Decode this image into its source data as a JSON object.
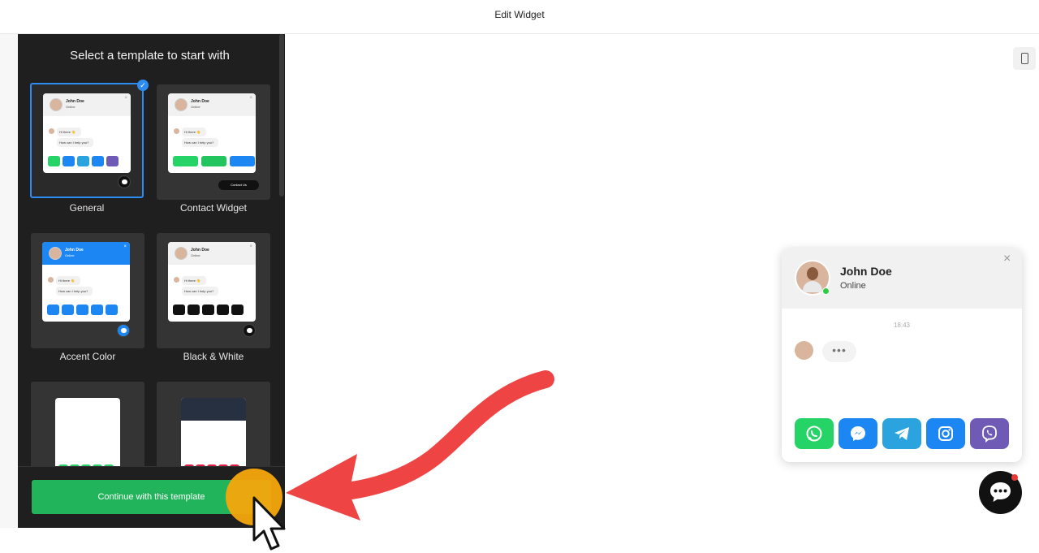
{
  "header": {
    "title": "Edit Widget"
  },
  "panel": {
    "heading": "Select a template to start with",
    "templates": [
      {
        "name": "General",
        "selected": true
      },
      {
        "name": "Contact Widget",
        "selected": false
      },
      {
        "name": "Accent Color",
        "selected": false
      },
      {
        "name": "Black & White",
        "selected": false
      },
      {
        "name": "",
        "selected": false
      },
      {
        "name": "",
        "selected": false
      }
    ],
    "continue_label": "Continue with this template"
  },
  "thumb": {
    "name": "John Doe",
    "status": "Online",
    "greeting": "Hi there 👋",
    "question": "How can I help you?",
    "contact_pill": "Contact Us"
  },
  "preview": {
    "name": "John Doe",
    "status": "Online",
    "time": "18:43",
    "typing": "•••",
    "close": "×",
    "channels": [
      {
        "icon": "whatsapp-icon",
        "color": "#25d366"
      },
      {
        "icon": "messenger-icon",
        "color": "#1c86f2"
      },
      {
        "icon": "telegram-icon",
        "color": "#2aa3df"
      },
      {
        "icon": "instagram-icon",
        "color": "#1c86f2"
      },
      {
        "icon": "viber-icon",
        "color": "#6f5bb5"
      }
    ]
  },
  "colors": {
    "accent": "#1c86f2",
    "continue": "#21b45a",
    "arrow": "#ef4444",
    "cursor_highlight": "#f5a70d"
  }
}
